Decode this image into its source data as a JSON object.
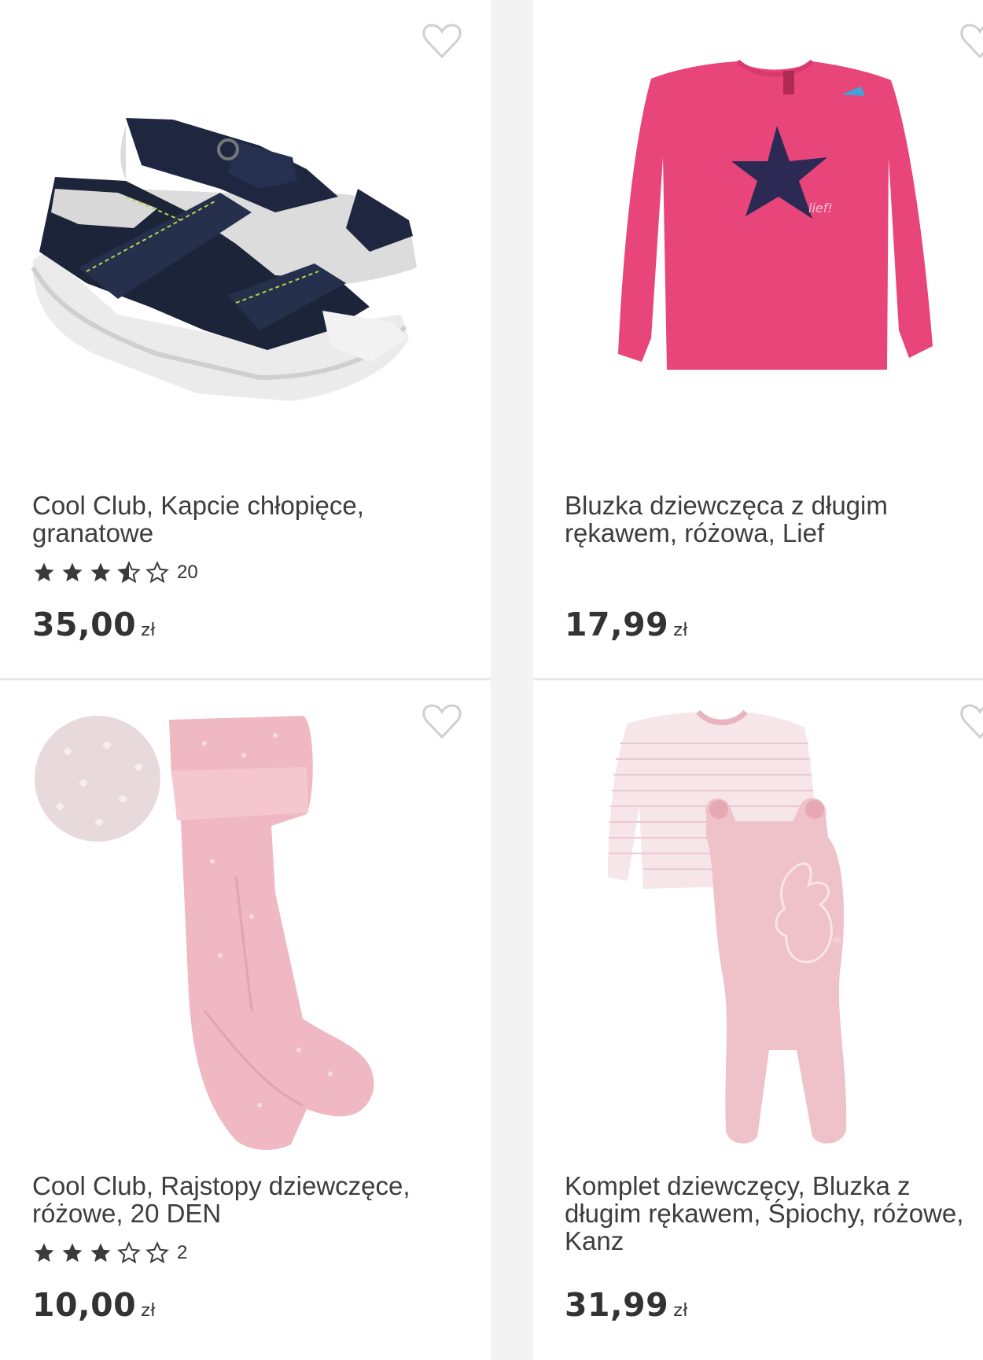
{
  "products": [
    {
      "title_line1": "Cool Club, Kapcie chłopięce,",
      "title_line2": "granatowe",
      "title_line3": "",
      "rating_stars": 3.5,
      "rating_count": "20",
      "price": "35,00",
      "currency": "zł",
      "image_icon": "sandals-image"
    },
    {
      "title_line1": "Bluzka dziewczęca z długim",
      "title_line2": "rękawem, różowa, Lief",
      "title_line3": "",
      "price": "17,99",
      "currency": "zł",
      "image_icon": "pink-shirt-image"
    },
    {
      "title_line1": "Cool Club, Rajstopy dziewczęce,",
      "title_line2": "różowe, 20 DEN",
      "title_line3": "",
      "rating_stars": 3,
      "rating_count": "2",
      "price": "10,00",
      "currency": "zł",
      "image_icon": "tights-image"
    },
    {
      "title_line1": "Komplet dziewczęcy, Bluzka z",
      "title_line2": "długim rękawem, Śpiochy, różowe,",
      "title_line3": "Kanz",
      "price": "31,99",
      "currency": "zł",
      "image_icon": "baby-set-image"
    }
  ],
  "colors": {
    "star": "#3a3a3a",
    "heart_outline": "#cfcfcf",
    "text": "#3d3d3d",
    "shirt_pink": "#e8457a",
    "light_pink": "#f0bcc4"
  }
}
